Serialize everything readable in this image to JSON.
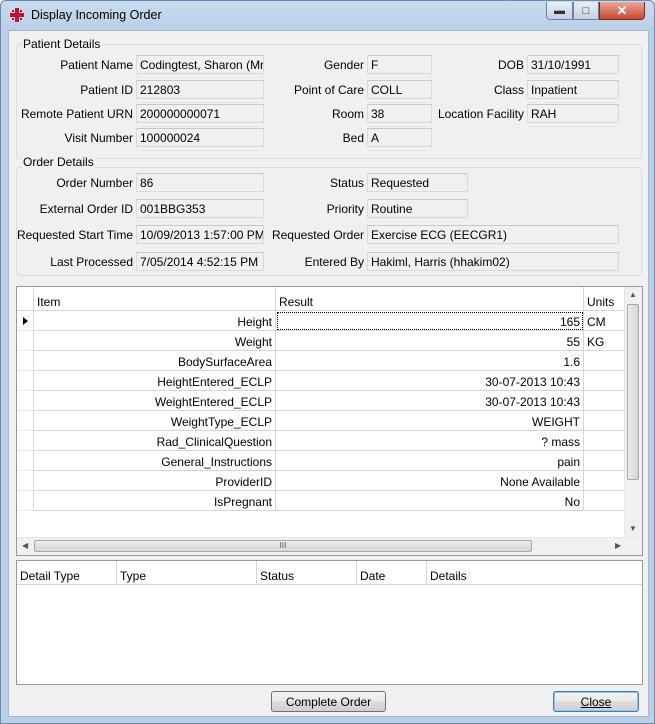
{
  "window": {
    "title": "Display Incoming Order"
  },
  "patient_details": {
    "group_title": "Patient Details",
    "patient_name": {
      "label": "Patient Name",
      "value": "Codingtest, Sharon (Mr)"
    },
    "patient_id": {
      "label": "Patient ID",
      "value": "212803"
    },
    "remote_patient_urn": {
      "label": "Remote Patient URN",
      "value": "200000000071"
    },
    "visit_number": {
      "label": "Visit Number",
      "value": "100000024"
    },
    "gender": {
      "label": "Gender",
      "value": "F"
    },
    "point_of_care": {
      "label": "Point of Care",
      "value": "COLL"
    },
    "room": {
      "label": "Room",
      "value": "38"
    },
    "bed": {
      "label": "Bed",
      "value": "A"
    },
    "dob": {
      "label": "DOB",
      "value": "31/10/1991"
    },
    "class": {
      "label": "Class",
      "value": "Inpatient"
    },
    "location_facility": {
      "label": "Location Facility",
      "value": "RAH"
    }
  },
  "order_details": {
    "group_title": "Order Details",
    "order_number": {
      "label": "Order Number",
      "value": "86"
    },
    "external_order_id": {
      "label": "External Order ID",
      "value": "001BBG353"
    },
    "requested_start_time": {
      "label": "Requested Start Time",
      "value": "10/09/2013 1:57:00 PM"
    },
    "last_processed": {
      "label": "Last Processed",
      "value": "7/05/2014 4:52:15 PM"
    },
    "status": {
      "label": "Status",
      "value": "Requested"
    },
    "priority": {
      "label": "Priority",
      "value": "Routine"
    },
    "requested_order": {
      "label": "Requested Order",
      "value": "Exercise ECG (EECGR1)"
    },
    "entered_by": {
      "label": "Entered By",
      "value": "Hakiml, Harris (hhakim02)"
    }
  },
  "results_grid": {
    "columns": [
      "Item",
      "Result",
      "Units"
    ],
    "rows": [
      {
        "item": "Height",
        "result": "165",
        "units": "CM"
      },
      {
        "item": "Weight",
        "result": "55",
        "units": "KG"
      },
      {
        "item": "BodySurfaceArea",
        "result": "1.6",
        "units": ""
      },
      {
        "item": "HeightEntered_ECLP",
        "result": "30-07-2013 10:43",
        "units": ""
      },
      {
        "item": "WeightEntered_ECLP",
        "result": "30-07-2013 10:43",
        "units": ""
      },
      {
        "item": "WeightType_ECLP",
        "result": "WEIGHT",
        "units": ""
      },
      {
        "item": "Rad_ClinicalQuestion",
        "result": "? mass",
        "units": ""
      },
      {
        "item": "General_Instructions",
        "result": "pain",
        "units": ""
      },
      {
        "item": "ProviderID",
        "result": "None Available",
        "units": ""
      },
      {
        "item": "IsPregnant",
        "result": "No",
        "units": ""
      }
    ],
    "hscroll_grip": "III"
  },
  "details_grid": {
    "columns": [
      "Detail Type",
      "Type",
      "Status",
      "Date",
      "Details"
    ]
  },
  "buttons": {
    "complete_order": "Complete Order",
    "close": "Close"
  }
}
